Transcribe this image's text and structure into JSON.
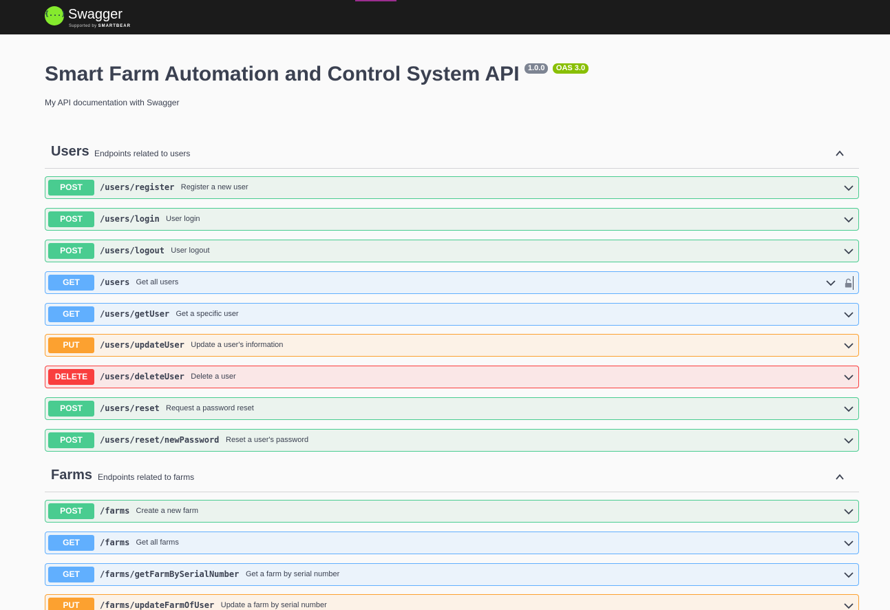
{
  "header": {
    "logo_name": "Swagger",
    "logo_glyph": "{...}",
    "logo_sub_prefix": "Supported by",
    "logo_sub_brand": "SMARTBEAR"
  },
  "info": {
    "title": "Smart Farm Automation and Control System API",
    "version": "1.0.0",
    "oas": "OAS 3.0",
    "description": "My API documentation with Swagger"
  },
  "colors": {
    "post": "#49cc90",
    "get": "#61affe",
    "put": "#fca130",
    "delete": "#f93e3e",
    "topbar": "#1b1b1b",
    "logo": "#85ea2d"
  },
  "tags": [
    {
      "name": "Users",
      "description": "Endpoints related to users",
      "operations": [
        {
          "method": "POST",
          "path": "/users/register",
          "summary": "Register a new user"
        },
        {
          "method": "POST",
          "path": "/users/login",
          "summary": "User login"
        },
        {
          "method": "POST",
          "path": "/users/logout",
          "summary": "User logout"
        },
        {
          "method": "GET",
          "path": "/users",
          "summary": "Get all users",
          "icon": "lock-icon"
        },
        {
          "method": "GET",
          "path": "/users/getUser",
          "summary": "Get a specific user"
        },
        {
          "method": "PUT",
          "path": "/users/updateUser",
          "summary": "Update a user's information"
        },
        {
          "method": "DELETE",
          "path": "/users/deleteUser",
          "summary": "Delete a user"
        },
        {
          "method": "POST",
          "path": "/users/reset",
          "summary": "Request a password reset"
        },
        {
          "method": "POST",
          "path": "/users/reset/newPassword",
          "summary": "Reset a user's password"
        }
      ]
    },
    {
      "name": "Farms",
      "description": "Endpoints related to farms",
      "operations": [
        {
          "method": "POST",
          "path": "/farms",
          "summary": "Create a new farm"
        },
        {
          "method": "GET",
          "path": "/farms",
          "summary": "Get all farms"
        },
        {
          "method": "GET",
          "path": "/farms/getFarmBySerialNumber",
          "summary": "Get a farm by serial number"
        },
        {
          "method": "PUT",
          "path": "/farms/updateFarmOfUser",
          "summary": "Update a farm by serial number"
        }
      ]
    }
  ]
}
